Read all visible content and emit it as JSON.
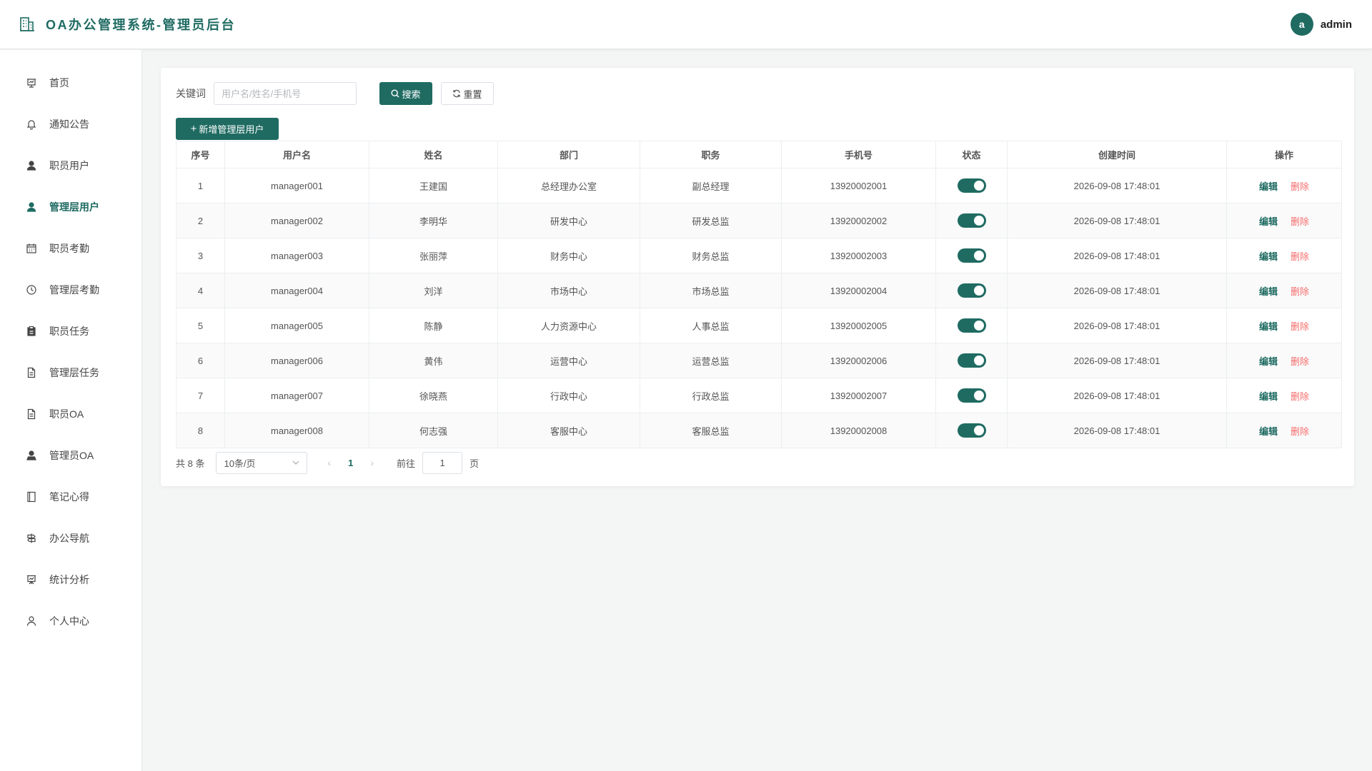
{
  "app": {
    "title": "OA办公管理系统-管理员后台",
    "accent": "#1f6b62"
  },
  "user": {
    "avatar_letter": "a",
    "name": "admin"
  },
  "sidebar": {
    "items": [
      {
        "label": "首页",
        "icon": "presentation-icon",
        "active": false
      },
      {
        "label": "通知公告",
        "icon": "bell-icon",
        "active": false
      },
      {
        "label": "职员用户",
        "icon": "user-icon",
        "active": false
      },
      {
        "label": "管理层用户",
        "icon": "user-icon",
        "active": true
      },
      {
        "label": "职员考勤",
        "icon": "calendar-icon",
        "active": false
      },
      {
        "label": "管理层考勤",
        "icon": "clock-icon",
        "active": false
      },
      {
        "label": "职员任务",
        "icon": "clipboard-icon",
        "active": false
      },
      {
        "label": "管理层任务",
        "icon": "document-icon",
        "active": false
      },
      {
        "label": "职员OA",
        "icon": "document-icon",
        "active": false
      },
      {
        "label": "管理员OA",
        "icon": "admin-user-icon",
        "active": false
      },
      {
        "label": "笔记心得",
        "icon": "notebook-icon",
        "active": false
      },
      {
        "label": "办公导航",
        "icon": "signpost-icon",
        "active": false
      },
      {
        "label": "统计分析",
        "icon": "chart-icon",
        "active": false
      },
      {
        "label": "个人中心",
        "icon": "user-outline-icon",
        "active": false
      }
    ]
  },
  "filters": {
    "keyword_label": "关键词",
    "keyword_placeholder": "用户名/姓名/手机号",
    "keyword_value": "",
    "search_label": "搜索",
    "reset_label": "重置"
  },
  "add_button_label": "新增管理层用户",
  "table": {
    "headers": [
      "序号",
      "用户名",
      "姓名",
      "部门",
      "职务",
      "手机号",
      "状态",
      "创建时间",
      "操作"
    ],
    "edit_label": "编辑",
    "delete_label": "删除",
    "rows": [
      {
        "no": "1",
        "username": "manager001",
        "name": "王建国",
        "dept": "总经理办公室",
        "title": "副总经理",
        "phone": "13920002001",
        "enabled": true,
        "created": "2026-09-08 17:48:01"
      },
      {
        "no": "2",
        "username": "manager002",
        "name": "李明华",
        "dept": "研发中心",
        "title": "研发总监",
        "phone": "13920002002",
        "enabled": true,
        "created": "2026-09-08 17:48:01"
      },
      {
        "no": "3",
        "username": "manager003",
        "name": "张丽萍",
        "dept": "财务中心",
        "title": "财务总监",
        "phone": "13920002003",
        "enabled": true,
        "created": "2026-09-08 17:48:01"
      },
      {
        "no": "4",
        "username": "manager004",
        "name": "刘洋",
        "dept": "市场中心",
        "title": "市场总监",
        "phone": "13920002004",
        "enabled": true,
        "created": "2026-09-08 17:48:01"
      },
      {
        "no": "5",
        "username": "manager005",
        "name": "陈静",
        "dept": "人力资源中心",
        "title": "人事总监",
        "phone": "13920002005",
        "enabled": true,
        "created": "2026-09-08 17:48:01"
      },
      {
        "no": "6",
        "username": "manager006",
        "name": "黄伟",
        "dept": "运营中心",
        "title": "运营总监",
        "phone": "13920002006",
        "enabled": true,
        "created": "2026-09-08 17:48:01"
      },
      {
        "no": "7",
        "username": "manager007",
        "name": "徐晓燕",
        "dept": "行政中心",
        "title": "行政总监",
        "phone": "13920002007",
        "enabled": true,
        "created": "2026-09-08 17:48:01"
      },
      {
        "no": "8",
        "username": "manager008",
        "name": "何志强",
        "dept": "客服中心",
        "title": "客服总监",
        "phone": "13920002008",
        "enabled": true,
        "created": "2026-09-08 17:48:01"
      }
    ]
  },
  "pagination": {
    "total_text": "共 8 条",
    "page_size": "10条/页",
    "current_page": "1",
    "goto_label": "前往",
    "goto_value": "1",
    "unit": "页"
  }
}
